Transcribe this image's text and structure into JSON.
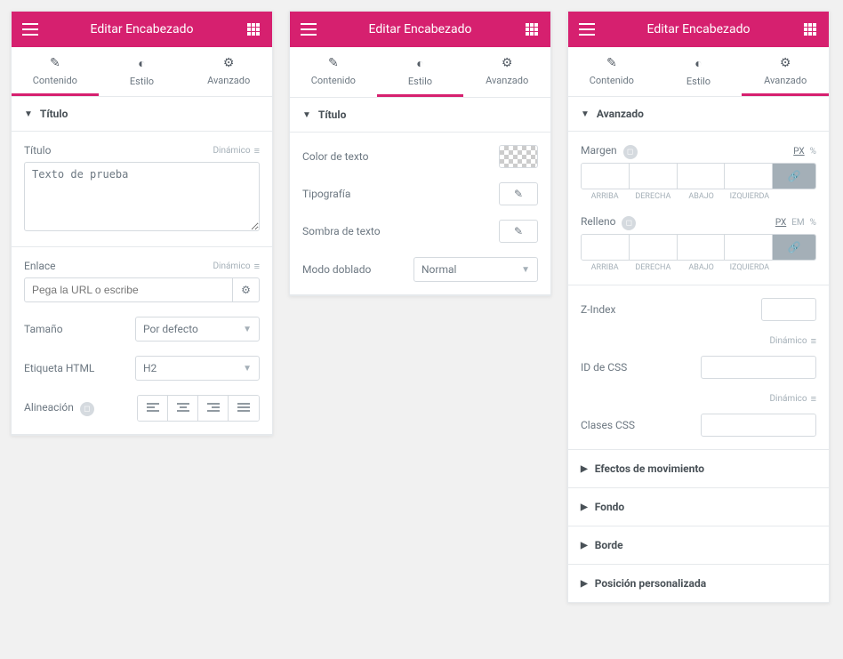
{
  "common": {
    "header_title": "Editar Encabezado",
    "tabs": {
      "content": "Contenido",
      "style": "Estilo",
      "advanced": "Avanzado"
    },
    "dynamic_label": "Dinámico"
  },
  "panel1": {
    "section_title": "Título",
    "title_label": "Título",
    "title_value": "Texto de prueba",
    "link_label": "Enlace",
    "link_placeholder": "Pega la URL o escribe",
    "size_label": "Tamaño",
    "size_value": "Por defecto",
    "html_tag_label": "Etiqueta HTML",
    "html_tag_value": "H2",
    "align_label": "Alineación"
  },
  "panel2": {
    "section_title": "Título",
    "text_color_label": "Color de texto",
    "typography_label": "Tipografía",
    "text_shadow_label": "Sombra de texto",
    "blend_label": "Modo doblado",
    "blend_value": "Normal"
  },
  "panel3": {
    "section_title": "Avanzado",
    "margin_label": "Margen",
    "padding_label": "Relleno",
    "units": {
      "px": "PX",
      "em": "EM",
      "pct": "%"
    },
    "sides": {
      "top": "ARRIBA",
      "right": "DERECHA",
      "bottom": "ABAJO",
      "left": "IZQUIERDA"
    },
    "zindex_label": "Z-Index",
    "css_id_label": "ID de CSS",
    "css_classes_label": "Clases CSS",
    "sections": {
      "motion": "Efectos de movimiento",
      "background": "Fondo",
      "border": "Borde",
      "custom_pos": "Posición personalizada"
    }
  }
}
